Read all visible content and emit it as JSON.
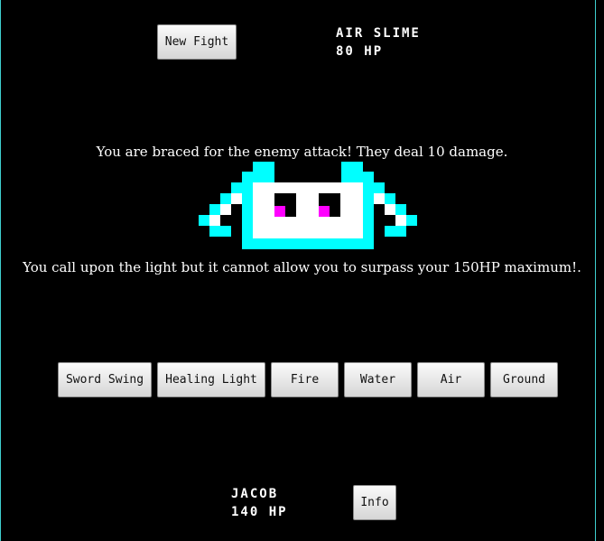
{
  "window": {
    "accent": "#3fcfcf",
    "background": "#000000"
  },
  "header": {
    "new_fight_label": "New Fight"
  },
  "enemy": {
    "name": "AIR SLIME",
    "hp_text": "80 HP",
    "sprite_colors": {
      "outline": "#00ffff",
      "body": "#ffffff",
      "eye": "#000000",
      "pupil": "#ff00ff"
    }
  },
  "battle_log": {
    "enemy_message": "You are braced for the enemy attack! They deal 10 damage.",
    "player_message": "You call upon the light but it cannot allow you to surpass your 150HP maximum!."
  },
  "actions": [
    {
      "label": "Sword Swing"
    },
    {
      "label": "Healing Light"
    },
    {
      "label": "Fire"
    },
    {
      "label": "Water"
    },
    {
      "label": "Air"
    },
    {
      "label": "Ground"
    }
  ],
  "player": {
    "name": "JACOB",
    "hp_text": "140 HP",
    "info_label": "Info"
  }
}
